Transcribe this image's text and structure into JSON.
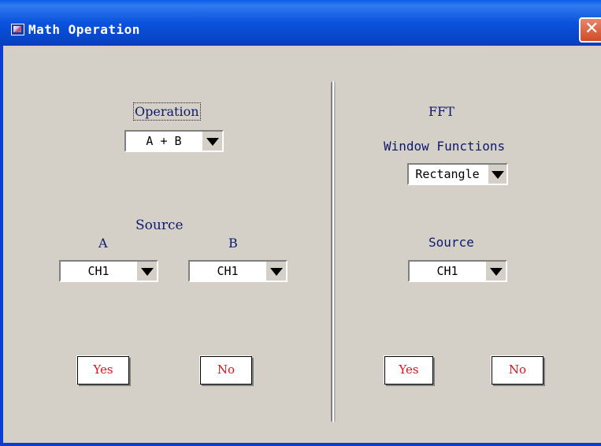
{
  "window": {
    "title": "Math Operation",
    "close_glyph": "✕"
  },
  "math": {
    "operation_label": "Operation",
    "operation_value": "A + B",
    "source_label": "Source",
    "a_label": "A",
    "b_label": "B",
    "a_value": "CH1",
    "b_value": "CH1",
    "yes_label": "Yes",
    "no_label": "No"
  },
  "fft": {
    "title": "FFT",
    "window_functions_label": "Window Functions",
    "window_function_value": "Rectangle",
    "source_label": "Source",
    "source_value": "CH1",
    "yes_label": "Yes",
    "no_label": "No"
  },
  "icons": {
    "app": "app-icon",
    "close": "close-icon",
    "dropdown": "dropdown-arrow-icon"
  },
  "colors": {
    "titlebar": "#0a52de",
    "window_bg": "#d4d0c8",
    "label_text": "#0d1a6b",
    "button_text": "#e0101a",
    "close_button": "#d14a28"
  }
}
